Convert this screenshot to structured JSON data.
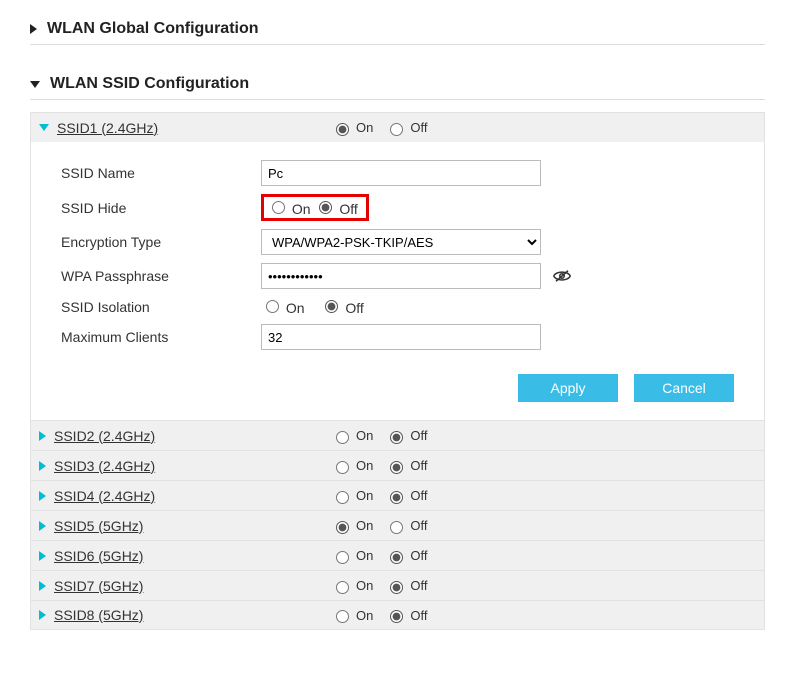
{
  "sections": {
    "global": {
      "title": "WLAN Global Configuration"
    },
    "ssid": {
      "title": "WLAN SSID Configuration"
    }
  },
  "labels": {
    "on": "On",
    "off": "Off",
    "ssid_name": "SSID Name",
    "ssid_hide": "SSID Hide",
    "encryption_type": "Encryption Type",
    "wpa_passphrase": "WPA Passphrase",
    "ssid_isolation": "SSID Isolation",
    "max_clients": "Maximum Clients",
    "apply": "Apply",
    "cancel": "Cancel"
  },
  "ssid1": {
    "name": "SSID1 (2.4GHz)",
    "enabled": "on",
    "ssid_name_value": "Pc",
    "hide": "off",
    "encryption_value": "WPA/WPA2-PSK-TKIP/AES",
    "passphrase": "••••••••••••",
    "isolation": "off",
    "max_clients": "32"
  },
  "ssid_rows": [
    {
      "name": "SSID2 (2.4GHz)",
      "enabled": "off"
    },
    {
      "name": "SSID3 (2.4GHz)",
      "enabled": "off"
    },
    {
      "name": "SSID4 (2.4GHz)",
      "enabled": "off"
    },
    {
      "name": "SSID5 (5GHz)",
      "enabled": "on"
    },
    {
      "name": "SSID6 (5GHz)",
      "enabled": "off"
    },
    {
      "name": "SSID7 (5GHz)",
      "enabled": "off"
    },
    {
      "name": "SSID8 (5GHz)",
      "enabled": "off"
    }
  ]
}
